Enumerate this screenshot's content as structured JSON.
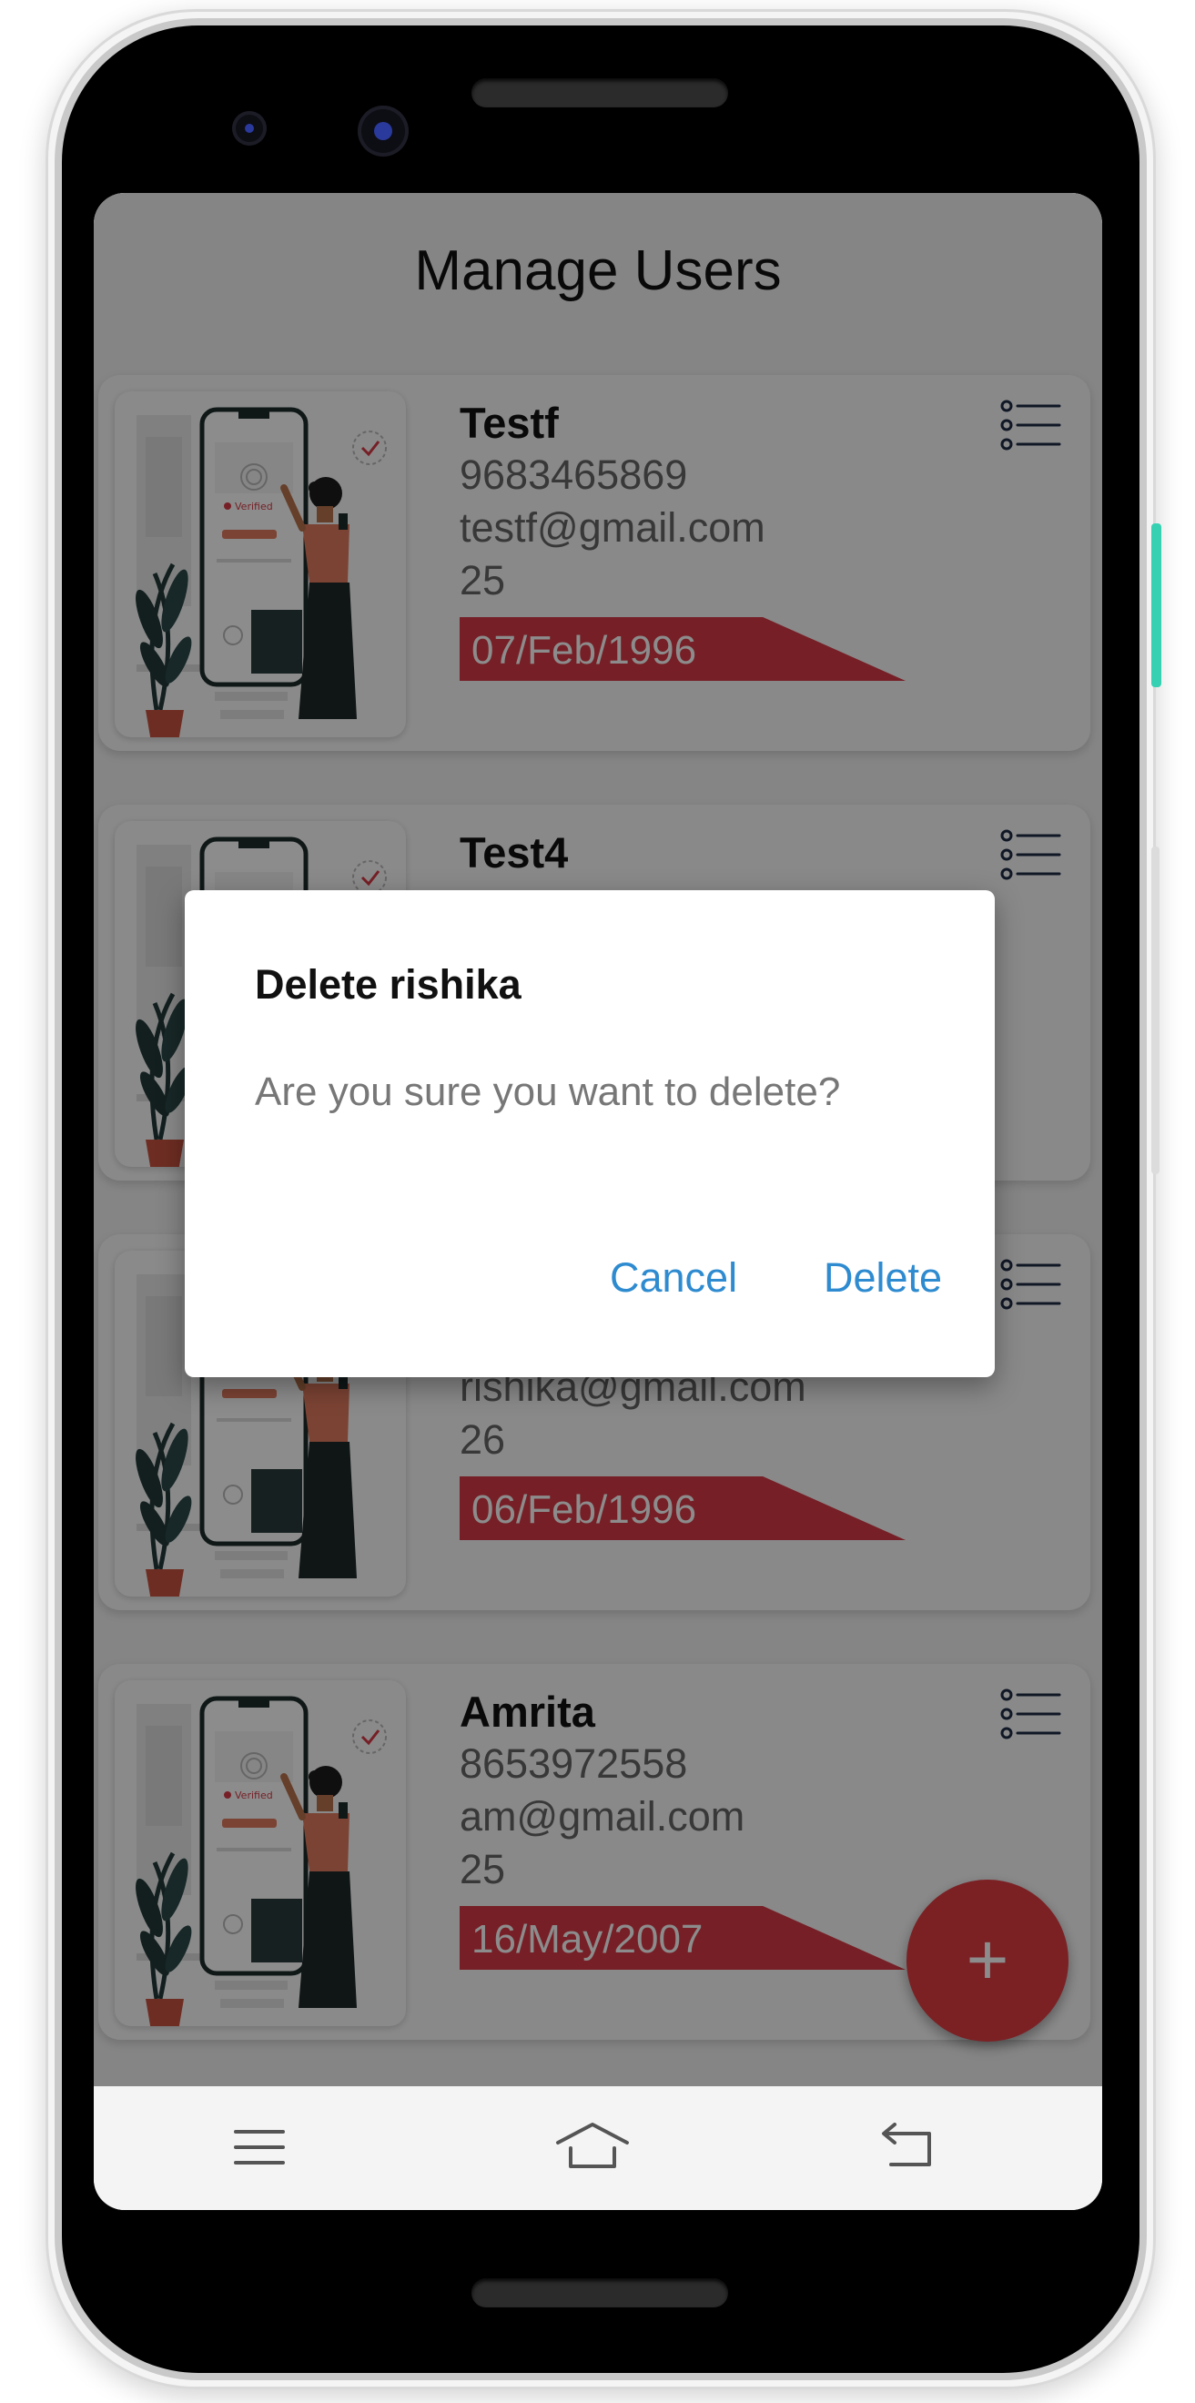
{
  "app": {
    "title": "Manage Users"
  },
  "users": [
    {
      "name": "Testf",
      "phone": "9683465869",
      "email": "testf@gmail.com",
      "age": "25",
      "dob": "07/Feb/1996"
    },
    {
      "name": "Test4",
      "phone": "",
      "email": "",
      "age": "",
      "dob": ""
    },
    {
      "name": "",
      "phone": "",
      "email": "rishika@gmail.com",
      "age": "26",
      "dob": "06/Feb/1996"
    },
    {
      "name": "Amrita",
      "phone": "8653972558",
      "email": "am@gmail.com",
      "age": "25",
      "dob": "16/May/2007"
    }
  ],
  "illustration": {
    "badge_text": "Verified"
  },
  "dialog": {
    "title": "Delete rishika",
    "message": "Are you sure you want to delete?",
    "cancel_label": "Cancel",
    "confirm_label": "Delete"
  },
  "fab": {
    "icon": "plus-icon",
    "label": "+"
  },
  "navbar": {
    "icons": [
      "menu-icon",
      "home-icon",
      "back-icon"
    ]
  },
  "colors": {
    "accent": "#d83a46",
    "link": "#2e8bd0",
    "fab": "#e03c43"
  }
}
